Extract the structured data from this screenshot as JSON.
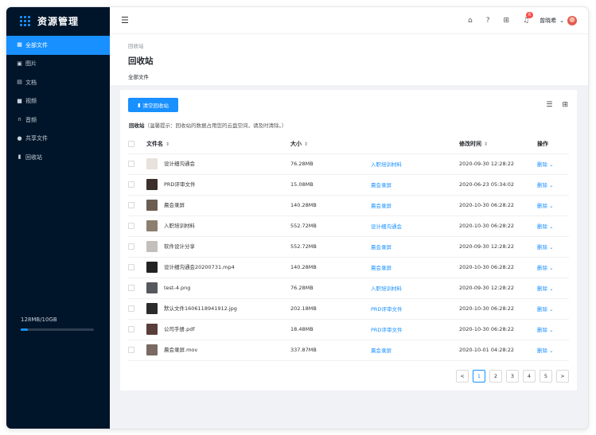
{
  "brand": {
    "title": "资源管理"
  },
  "sidebar": {
    "items": [
      {
        "label": "全部文件",
        "icon": "grid-icon"
      },
      {
        "label": "图片",
        "icon": "image-icon"
      },
      {
        "label": "文档",
        "icon": "document-icon"
      },
      {
        "label": "视频",
        "icon": "video-icon"
      },
      {
        "label": "音频",
        "icon": "headphones-icon"
      },
      {
        "label": "共享文件",
        "icon": "users-icon"
      },
      {
        "label": "回收站",
        "icon": "trash-icon"
      }
    ],
    "storage_text": "128MB/10GB",
    "storage_fraction": 0.1
  },
  "topbar": {
    "notifications": "6",
    "username": "曾晓希"
  },
  "header": {
    "breadcrumb": "回收站",
    "title": "回收站",
    "subtitle": "全部文件"
  },
  "card": {
    "clear_button": "清空回收站",
    "tip_label": "回收站",
    "tip_text": "（温馨提示：回收站的数据占用您的云盘空间，请及时清除。）"
  },
  "table": {
    "headers": {
      "name": "文件名",
      "size": "大小",
      "time": "修改时间",
      "ops": "操作"
    },
    "rows": [
      {
        "name": "设计细沟通会",
        "size": "76.28MB",
        "folder": "入职培训材料",
        "time": "2020-09-30 12:28:22",
        "op": "删除",
        "thumb": "#e8e2dc"
      },
      {
        "name": "PRD评审文件",
        "size": "15.08MB",
        "folder": "晨会录屏",
        "time": "2020-06-23 05:34:02",
        "op": "删除",
        "thumb": "#3a2f2a"
      },
      {
        "name": "晨会录屏",
        "size": "140.28MB",
        "folder": "晨会录屏",
        "time": "2020-10-30 06:28:22",
        "op": "删除",
        "thumb": "#6b5d52"
      },
      {
        "name": "入职培训材料",
        "size": "552.72MB",
        "folder": "设计细沟通会",
        "time": "2020-10-30 06:28:22",
        "op": "删除",
        "thumb": "#8c7f6e"
      },
      {
        "name": "软件设计分享",
        "size": "552.72MB",
        "folder": "晨会录屏",
        "time": "2020-09-30 12:28:22",
        "op": "删除",
        "thumb": "#c4bfbb"
      },
      {
        "name": "设计细沟通会20200731.mp4",
        "size": "140.28MB",
        "folder": "晨会录屏",
        "time": "2020-10-30 06:28:22",
        "op": "删除",
        "thumb": "#222222"
      },
      {
        "name": "test-4.png",
        "size": "76.28MB",
        "folder": "入职培训材料",
        "time": "2020-09-30 12:28:22",
        "op": "删除",
        "thumb": "#55585d"
      },
      {
        "name": "默认文件1606118941912.jpg",
        "size": "202.18MB",
        "folder": "PRD评审文件",
        "time": "2020-10-30 06:28:22",
        "op": "删除",
        "thumb": "#2b2b2b"
      },
      {
        "name": "公司手册.pdf",
        "size": "18.48MB",
        "folder": "PRD评审文件",
        "time": "2020-10-30 06:28:22",
        "op": "删除",
        "thumb": "#5a3e3a"
      },
      {
        "name": "晨会录屏.mov",
        "size": "337.87MB",
        "folder": "晨会录屏",
        "time": "2020-10-01 04:28:22",
        "op": "删除",
        "thumb": "#7a6a62"
      }
    ]
  },
  "pagination": {
    "prev": "<",
    "pages": [
      "1",
      "2",
      "3",
      "4",
      "5"
    ],
    "next": ">",
    "current": "1"
  },
  "colors": {
    "accent": "#1890ff",
    "sidebar": "#001529"
  }
}
